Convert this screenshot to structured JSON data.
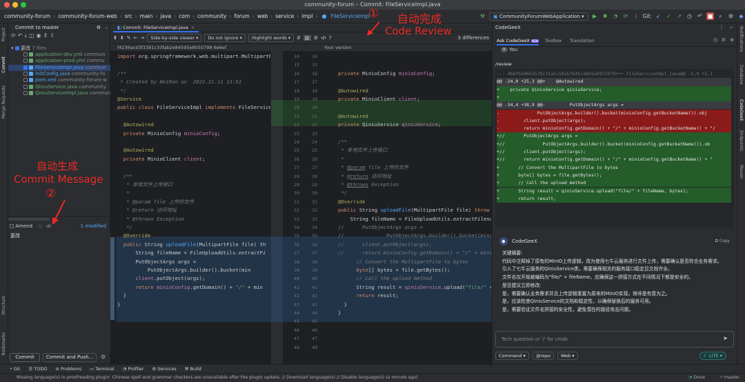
{
  "window": {
    "title": "community-forum – Commit: FileServiceImpl.java"
  },
  "navbar": {
    "breadcrumbs": [
      "community-forum",
      "community-forum-web",
      "src",
      "main",
      "java",
      "com",
      "community",
      "forum",
      "web",
      "service",
      "impl",
      "FileServiceImpl"
    ],
    "run_config": "CommunityForumWebApplication",
    "git_label": "Git:"
  },
  "left_strip": {
    "items": [
      "Project",
      "Commit",
      "Merge Requests",
      "Structure",
      "Bookmarks"
    ]
  },
  "commit_panel": {
    "tab": "Commit to master",
    "changes_header": "更改",
    "changes_count": "7 files",
    "files": [
      {
        "name": "application-dev.yml",
        "path": "commun",
        "color": "#6aab73",
        "checked": false
      },
      {
        "name": "application-prod.yml",
        "path": "commu",
        "color": "#6aab73",
        "checked": false
      },
      {
        "name": "FileServiceImpl.java",
        "path": "commun",
        "color": "#56a8f5",
        "checked": true
      },
      {
        "name": "InitConfig.java",
        "path": "community-fo",
        "color": "#56a8f5",
        "checked": false
      },
      {
        "name": "pom.xml",
        "path": "community-forum-w",
        "color": "#56a8f5",
        "checked": false
      },
      {
        "name": "QiniuService.java",
        "path": "community",
        "color": "#6aab73",
        "checked": false
      },
      {
        "name": "QiniuServiceImpl.java",
        "path": "commun",
        "color": "#6aab73",
        "checked": false
      }
    ],
    "amend_label": "Amend",
    "modified_label": "1 modified",
    "message": "更改",
    "commit_button": "Commit",
    "commit_push_button": "Commit and Push..."
  },
  "diff": {
    "tab": "Commit: FileServiceImpl.java",
    "viewer": "Side-by-side viewer",
    "ignore": "Do not ignore",
    "highlight": "Highlight words",
    "differences": "3 differences",
    "left_header": "f4236acd3f3391c33fab2e84595e8050798 6e6ef",
    "right_header": "Your version",
    "left_numbers": [
      "",
      "",
      "",
      "",
      "",
      "",
      "",
      "",
      "",
      "",
      "",
      "",
      "",
      "",
      "",
      "",
      "",
      "",
      "",
      "",
      "",
      "",
      "",
      "",
      "",
      "",
      "",
      "",
      "",
      "",
      "",
      "",
      "",
      "",
      ""
    ],
    "right_numbers": [
      "10",
      "15",
      "16",
      "17",
      "18",
      "19",
      "20",
      "21",
      "22",
      "23",
      "24",
      "25",
      "26",
      "27",
      "28",
      "29",
      "30",
      "31",
      "32",
      "33",
      "34",
      "35",
      "36",
      "37",
      "38",
      "39",
      "40",
      "41",
      "42",
      "43",
      "44",
      "45",
      "46",
      "47",
      "48"
    ]
  },
  "right_panel": {
    "title": "CodeGeeX",
    "tabs": [
      "Ask CodeGeeX",
      "Toolbox",
      "Translation"
    ],
    "user_label": "You",
    "review_cmd": "/review",
    "diff_lines": [
      "--- 4b8fb3d66157bc21a5c58cb7b45cab65a9972079+++ FileServiceImpl.java@@ -5,0 +5,1",
      "@@ -24,0 +25,3 @@+    @Autowired",
      "+    private QiniuService qiniuService;",
      "+",
      "@@ -34,4 +38,9 @@-         PutObjectArgs args =",
      "-              PutObjectArgs.builder().bucket(minioConfig.getBucketName()).obj",
      "-         client.putObject(args);",
      "-         return minioConfig.getDomain() + \"/\" + minioConfig.getBucketName() + \"/",
      "+//       PutObjectArgs args =",
      "+//              PutObjectArgs.builder().bucket(minioConfig.getBucketName()).ob",
      "+//       client.putObject(args);",
      "+//       return minioConfig.getDomain() + \"/\" + minioConfig.getBucketName() + \"",
      "+       // Convert the MultipartFile to bytes",
      "+       byte[] bytes = file.getBytes();",
      "+       // Call the upload method",
      "+       String result = qiniuService.upload(\"file/\" + fileName, bytes);",
      "+       return result;"
    ],
    "bot_name": "CodeGeeX",
    "copy_label": "Copy",
    "response": [
      "关键摘要:",
      "代码中注释掉了原有的MinIO上传逻辑，改为使用七牛云服务进行文件上传，需要确认是否符合业务需求。",
      "引入了七牛云服务的QiniuService类，需要确保相关的服务接口稳定且文档齐全。",
      "文件名仅开始被编码为\"file/\" + fileName，应确保这一拼接方式在不同情况下都是安全的。",
      "是否建议立即修改:",
      "是，需要确认业务需求并且上传逻辑重置为原来的MinIO实现，除非是有意为之。",
      "是，应该检查QiniuService的文档和稳定性，以确保替换后的服务可用。",
      "是，需要验证文件名拼接的安全性，避免潜在的路径攻击问题。"
    ],
    "input_placeholder": "Tech question or '/' for cmds",
    "footer_buttons": [
      "Command",
      "@repo",
      "Web"
    ],
    "lite_label": "LITE"
  },
  "right_strip": {
    "items": [
      "Notifications",
      "Database",
      "CodeGeeX",
      "Endpoints",
      "Maven"
    ]
  },
  "annotations": {
    "top_num": "①",
    "top_line1": "自动完成",
    "top_line2": "Code Review",
    "left_line1": "自动生成",
    "left_line2": "Commit Message",
    "left_num": "②"
  },
  "toolwindows": [
    "Git",
    "TODO",
    "Problems",
    "Terminal",
    "Profiler",
    "Services",
    "Build"
  ],
  "status": {
    "message": "Missing language(s) in proofreading plugin: Chinese spell and grammar checkers are unavailable after the plugin update. // Download language(s) // Disable language(s) (a minute ago)",
    "done": "Done",
    "branch": "master"
  }
}
